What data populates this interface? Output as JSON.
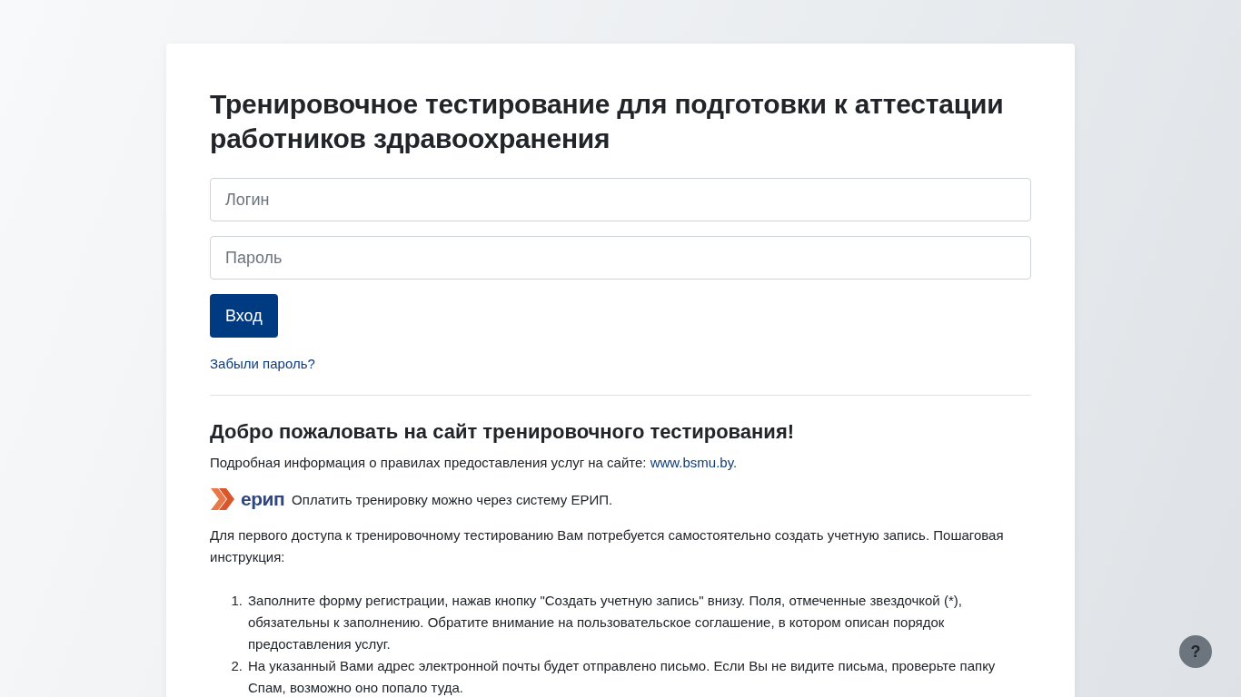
{
  "title": "Тренировочное тестирование для подготовки к аттестации работников здравоохранения",
  "login": {
    "placeholder": "Логин"
  },
  "password": {
    "placeholder": "Пароль"
  },
  "submit": "Вход",
  "forgot_link": "Забыли пароль?",
  "welcome": {
    "heading": "Добро пожаловать на сайт тренировочного тестирования!",
    "info_text": "Подробная информация о правилах предоставления услуг на сайте:",
    "info_link": "www.bsmu.by.",
    "erip_logo": "ерип",
    "erip_text": "Оплатить тренировку можно через систему ЕРИП.",
    "intro": "Для первого доступа к тренировочному тестированию Вам потребуется самостоятельно создать учетную запись. Пошаговая инструкция:",
    "steps": [
      {
        "number": "1.",
        "text": "Заполните форму регистрации, нажав кнопку \"Создать учетную запись\" внизу. Поля, отмеченные звездочкой (*), обязательны к заполнению. Обратите внимание на пользовательское соглашение, в котором описан порядок предоставления услуг."
      },
      {
        "number": "2.",
        "text": "На указанный Вами адрес электронной почты будет отправлено письмо. Если Вы не видите письма, проверьте папку Спам, возможно оно попало туда."
      }
    ]
  },
  "help_button": "?"
}
